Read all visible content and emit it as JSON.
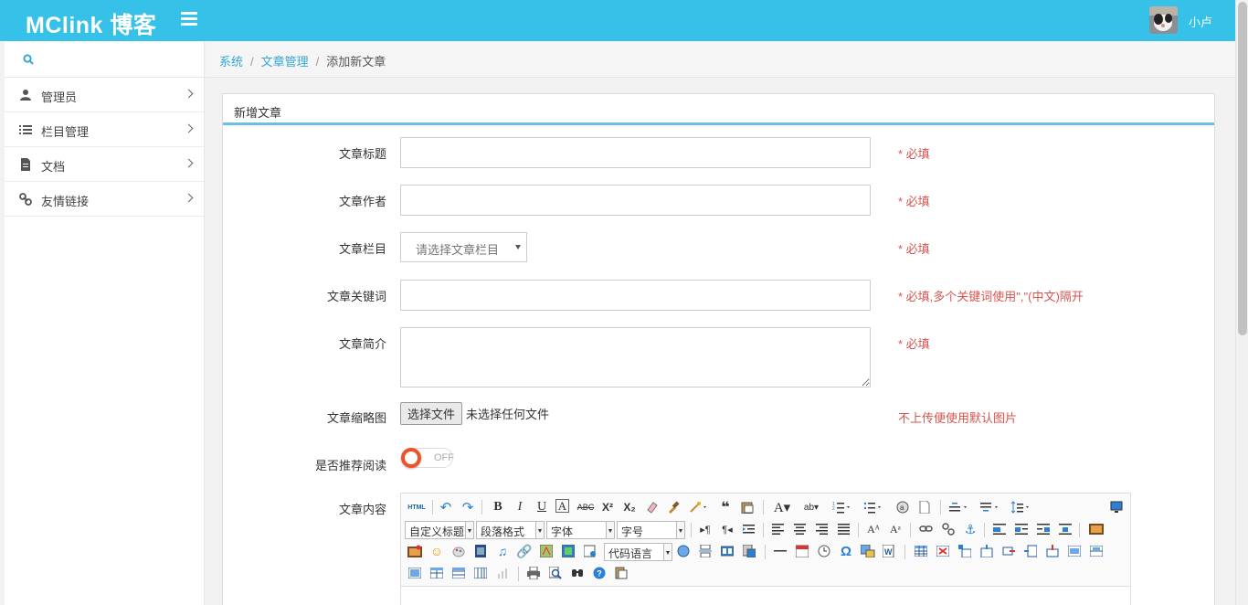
{
  "header": {
    "brand": "MClink  博客",
    "username": "小卢"
  },
  "sidebar": {
    "items": [
      {
        "label": "管理员"
      },
      {
        "label": "栏目管理"
      },
      {
        "label": "文档"
      },
      {
        "label": "友情链接"
      }
    ]
  },
  "breadcrumb": {
    "system": "系统",
    "articles": "文章管理",
    "current": "添加新文章",
    "sep": "/"
  },
  "panel": {
    "title": "新增文章"
  },
  "form": {
    "title_label": "文章标题",
    "title_hint": "* 必填",
    "author_label": "文章作者",
    "author_hint": "* 必填",
    "category_label": "文章栏目",
    "category_value": "请选择文章栏目",
    "category_hint": "* 必填",
    "keywords_label": "文章关键词",
    "keywords_hint": "* 必填,多个关键词使用\",\"(中文)隔开",
    "summary_label": "文章简介",
    "summary_hint": "* 必填",
    "thumb_label": "文章缩略图",
    "thumb_button": "选择文件",
    "thumb_status": "未选择任何文件",
    "thumb_hint": "不上传便使用默认图片",
    "recommend_label": "是否推荐阅读",
    "recommend_state": "OFF",
    "content_label": "文章内容"
  },
  "editor": {
    "combo_heading": "自定义标题",
    "combo_paragraph": "段落格式",
    "combo_font": "字体",
    "combo_size": "字号",
    "combo_code": "代码语言",
    "html_btn": "HTML"
  },
  "colors": {
    "accent": "#35c1e8",
    "required": "#d9534f",
    "toggle": "#f05228"
  }
}
